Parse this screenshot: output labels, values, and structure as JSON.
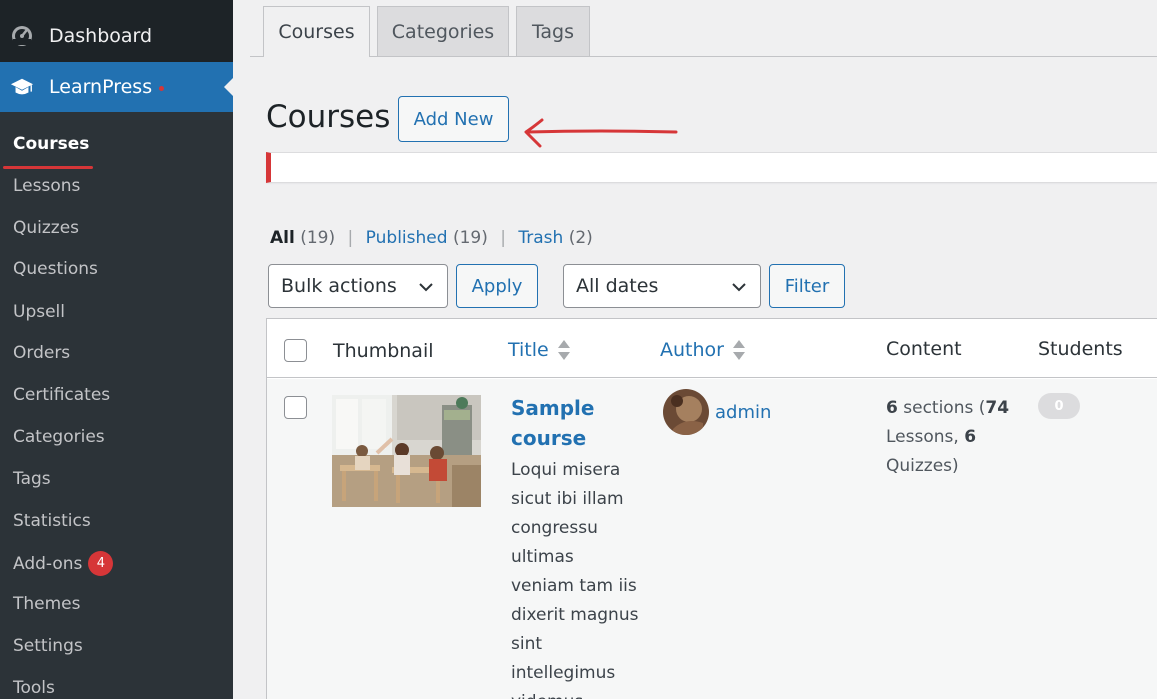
{
  "sidebar": {
    "dashboard_label": "Dashboard",
    "learnpress_label": "LearnPress",
    "submenu": [
      {
        "label": "Courses",
        "current": true
      },
      {
        "label": "Lessons"
      },
      {
        "label": "Quizzes"
      },
      {
        "label": "Questions"
      },
      {
        "label": "Upsell"
      },
      {
        "label": "Orders"
      },
      {
        "label": "Certificates"
      },
      {
        "label": "Categories"
      },
      {
        "label": "Tags"
      },
      {
        "label": "Statistics"
      },
      {
        "label": "Add-ons",
        "badge": "4"
      },
      {
        "label": "Themes"
      },
      {
        "label": "Settings"
      },
      {
        "label": "Tools"
      }
    ]
  },
  "tabs": [
    {
      "label": "Courses",
      "active": true
    },
    {
      "label": "Categories"
    },
    {
      "label": "Tags"
    }
  ],
  "page": {
    "title": "Courses",
    "add_new_label": "Add New"
  },
  "status_links": {
    "all_label": "All",
    "all_count": "(19)",
    "published_label": "Published",
    "published_count": "(19)",
    "trash_label": "Trash",
    "trash_count": "(2)",
    "separator": "|"
  },
  "actions": {
    "bulk_select": "Bulk actions",
    "apply_label": "Apply",
    "dates_select": "All dates",
    "filter_label": "Filter"
  },
  "table": {
    "columns": [
      "Thumbnail",
      "Title",
      "Author",
      "Content",
      "Students"
    ],
    "rows": [
      {
        "title": "Sample course",
        "excerpt": "Loqui misera sicut ibi illam congressu ultimas veniam tam iis dixerit magnus sint intellegimus videmus",
        "author": "admin",
        "sections": "6",
        "sections_word": "sections (",
        "lessons": "74",
        "lessons_word": "Lessons,",
        "quizzes": "6",
        "quizzes_word": "Quizzes)",
        "students": "0"
      }
    ]
  },
  "colors": {
    "accent": "#2271b1",
    "sidebar_bg": "#1d2327",
    "submenu_bg": "#2c3338",
    "annotation_red": "#d63638"
  },
  "icons": {
    "dashboard": "dashboard-gauge-icon",
    "learnpress": "graduation-cap-icon",
    "dropdown": "chevron-down-icon",
    "sort": "sort-arrows-icon",
    "annotation": "red-arrow-annotation"
  }
}
